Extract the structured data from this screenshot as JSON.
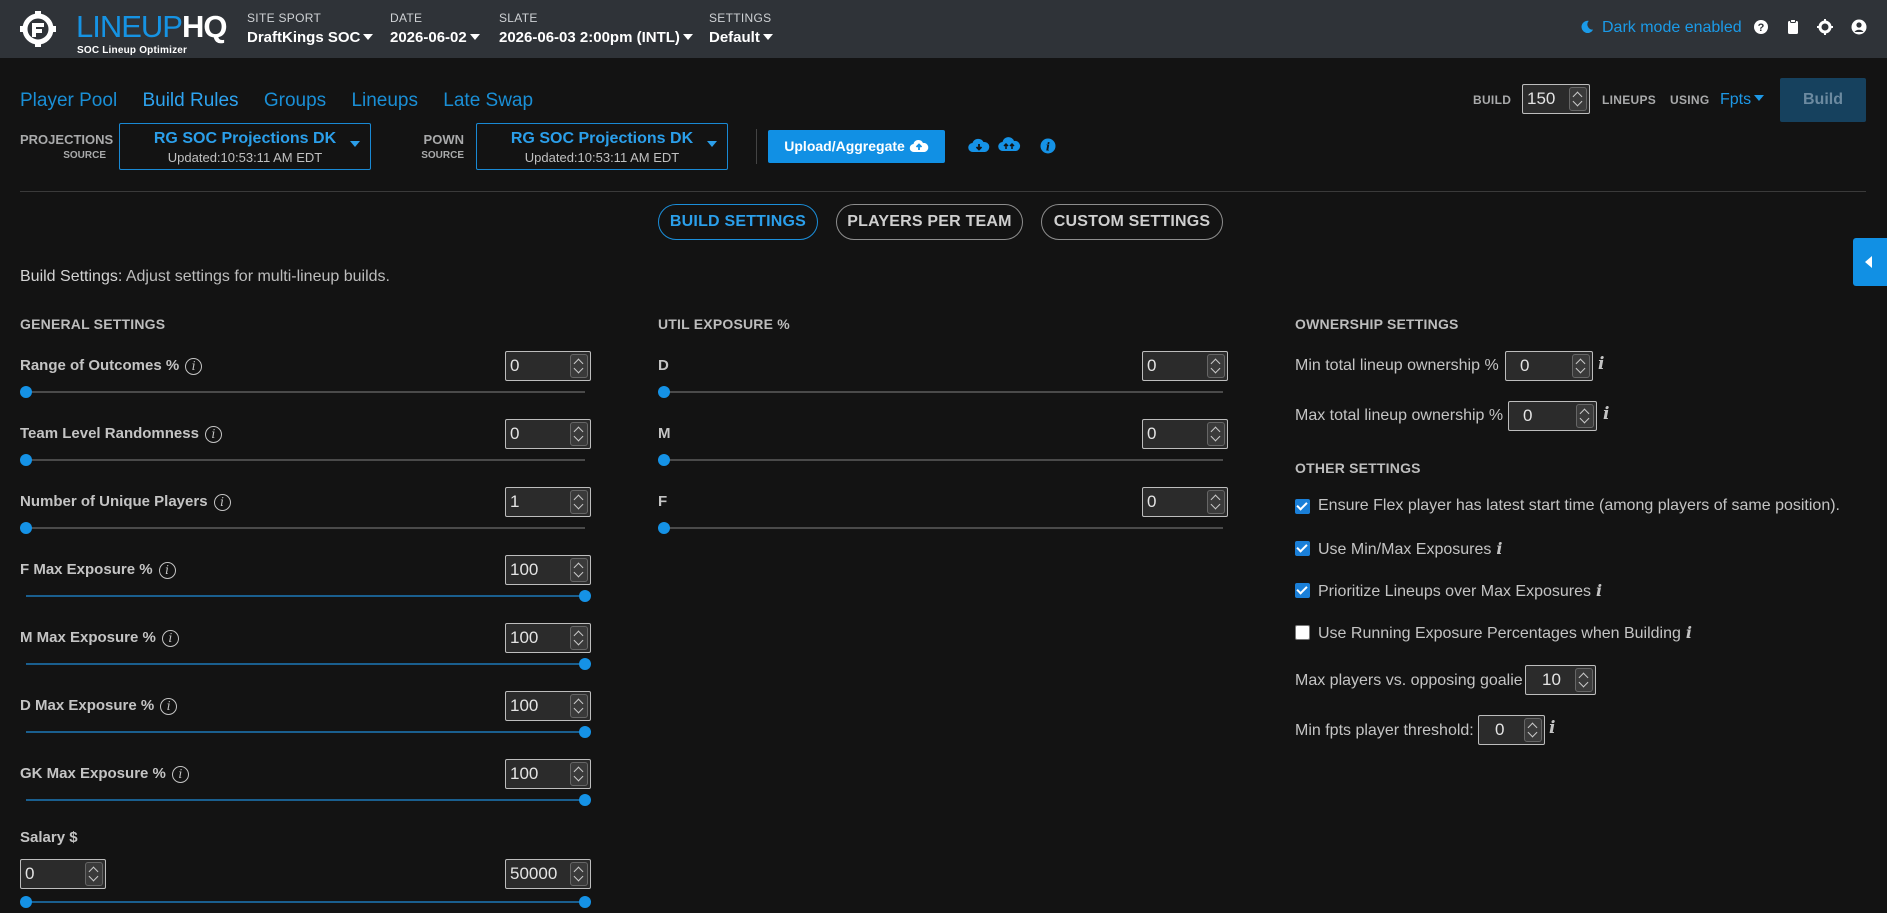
{
  "logo": {
    "text_lineup": "LINEUP",
    "text_hq": "HQ",
    "subtitle": "SOC Lineup Optimizer"
  },
  "topbar": {
    "site_sport_label": "SITE SPORT",
    "site_sport_value": "DraftKings SOC",
    "date_label": "DATE",
    "date_value": "2026-06-02",
    "slate_label": "SLATE",
    "slate_value": "2026-06-03 2:00pm (INTL)",
    "settings_label": "SETTINGS",
    "settings_value": "Default",
    "dark_mode_text": "Dark mode enabled",
    "icons": [
      "help-icon",
      "clipboard-icon",
      "gear-icon",
      "user-icon"
    ]
  },
  "nav": {
    "tabs": [
      "Player Pool",
      "Build Rules",
      "Groups",
      "Lineups",
      "Late Swap"
    ],
    "active": "Build Rules"
  },
  "build": {
    "build_label": "BUILD",
    "count": "150",
    "lineups_label": "LINEUPS",
    "using_label": "USING",
    "using_value": "Fpts",
    "button_label": "Build"
  },
  "sources": {
    "projections_label": "PROJECTIONS",
    "projections_sub": "SOURCE",
    "projections_value": "RG SOC Projections DK",
    "projections_updated": "Updated:10:53:11 AM EDT",
    "pown_label": "POWN",
    "pown_sub": "SOURCE",
    "pown_value": "RG SOC Projections DK",
    "pown_updated": "Updated:10:53:11 AM EDT",
    "upload_label": "Upload/Aggregate"
  },
  "settings_tabs": [
    "BUILD SETTINGS",
    "PLAYERS PER TEAM",
    "CUSTOM SETTINGS"
  ],
  "intro": {
    "title": "Build Settings:",
    "text": "Adjust settings for multi-lineup builds."
  },
  "general": {
    "title": "GENERAL SETTINGS",
    "rows": [
      {
        "label": "Range of Outcomes %",
        "value": "0",
        "level": 0
      },
      {
        "label": "Team Level Randomness",
        "value": "0",
        "level": 0
      },
      {
        "label": "Number of Unique Players",
        "value": "1",
        "level": 0
      },
      {
        "label": "F Max Exposure %",
        "value": "100",
        "level": 1
      },
      {
        "label": "M Max Exposure %",
        "value": "100",
        "level": 1
      },
      {
        "label": "D Max Exposure %",
        "value": "100",
        "level": 1
      },
      {
        "label": "GK Max Exposure %",
        "value": "100",
        "level": 1
      }
    ],
    "salary": {
      "label": "Salary $",
      "min": "0",
      "max": "50000"
    }
  },
  "util": {
    "title": "UTIL EXPOSURE %",
    "rows": [
      {
        "label": "D",
        "value": "0",
        "level": 0
      },
      {
        "label": "M",
        "value": "0",
        "level": 0
      },
      {
        "label": "F",
        "value": "0",
        "level": 0
      }
    ]
  },
  "ownership": {
    "title": "OWNERSHIP SETTINGS",
    "min_label": "Min total lineup ownership %",
    "min_value": "0",
    "max_label": "Max total lineup ownership %",
    "max_value": "0"
  },
  "other": {
    "title": "OTHER SETTINGS",
    "checks": [
      {
        "label": "Ensure Flex player has latest start time (among players of same position).",
        "checked": true,
        "info": false
      },
      {
        "label": "Use Min/Max Exposures",
        "checked": true,
        "info": true
      },
      {
        "label": "Prioritize Lineups over Max Exposures",
        "checked": true,
        "info": true
      },
      {
        "label": "Use Running Exposure Percentages when Building",
        "checked": false,
        "info": true
      }
    ],
    "goalie_label": "Max players vs. opposing goalie",
    "goalie_value": "10",
    "fpts_label": "Min fpts player threshold:",
    "fpts_value": "0"
  },
  "colors": {
    "accent": "#1592e6",
    "background": "#131313",
    "topbar": "#2f3338"
  }
}
